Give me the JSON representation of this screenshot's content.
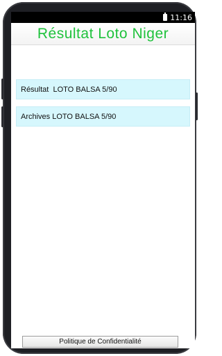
{
  "status_bar": {
    "time": "11:16",
    "battery_icon": "battery-icon"
  },
  "app": {
    "title": "Résultat Loto Niger"
  },
  "menu": {
    "items": [
      {
        "label": "Résultat  LOTO BALSA 5/90"
      },
      {
        "label": "Archives LOTO BALSA 5/90"
      }
    ]
  },
  "footer": {
    "privacy_label": "Politique de Confidentialité"
  },
  "colors": {
    "title": "#1fc23c",
    "menu_bg": "#d6f7fd",
    "frame": "#1e1f24"
  }
}
